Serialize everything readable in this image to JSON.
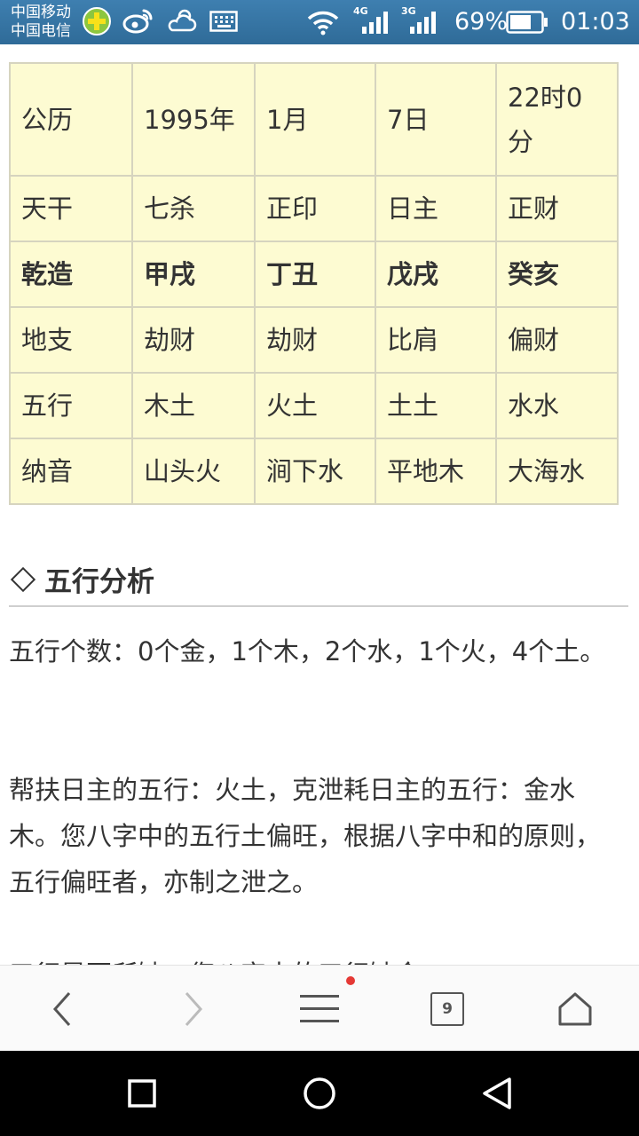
{
  "status_bar": {
    "carrier_1": "中国移动",
    "carrier_2": "中国电信",
    "net_1": "4G",
    "net_2": "3G",
    "battery": "69%",
    "time": "01:03"
  },
  "bazi_table": {
    "rows": [
      [
        "公历",
        "1995年",
        "1月",
        "7日",
        "22时0分"
      ],
      [
        "天干",
        "七杀",
        "正印",
        "日主",
        "正财"
      ],
      [
        "乾造",
        "甲戌",
        "丁丑",
        "戊戌",
        "癸亥"
      ],
      [
        "地支",
        "劫财",
        "劫财",
        "比肩",
        "偏财"
      ],
      [
        "五行",
        "木土",
        "火土",
        "土土",
        "水水"
      ],
      [
        "纳音",
        "山头火",
        "涧下水",
        "平地木",
        "大海水"
      ]
    ]
  },
  "section": {
    "title": "五行分析"
  },
  "paragraphs": {
    "p1": "五行个数：0个金，1个木，2个水，1个火，4个土。",
    "p2": "帮扶日主的五行：火土，克泄耗日主的五行：金水木。您八字中的五行土偏旺，根据八字中和的原则，五行偏旺者，亦制之泄之。",
    "p3": "五行是否所缺：您八字中的五行缺金。"
  },
  "toolbar": {
    "tab_count": "9"
  },
  "colors": {
    "status_bar": "#3a7aab",
    "table_bg": "#fdfbd2",
    "table_border": "#d6d4bf",
    "notification_dot": "#e53935"
  }
}
